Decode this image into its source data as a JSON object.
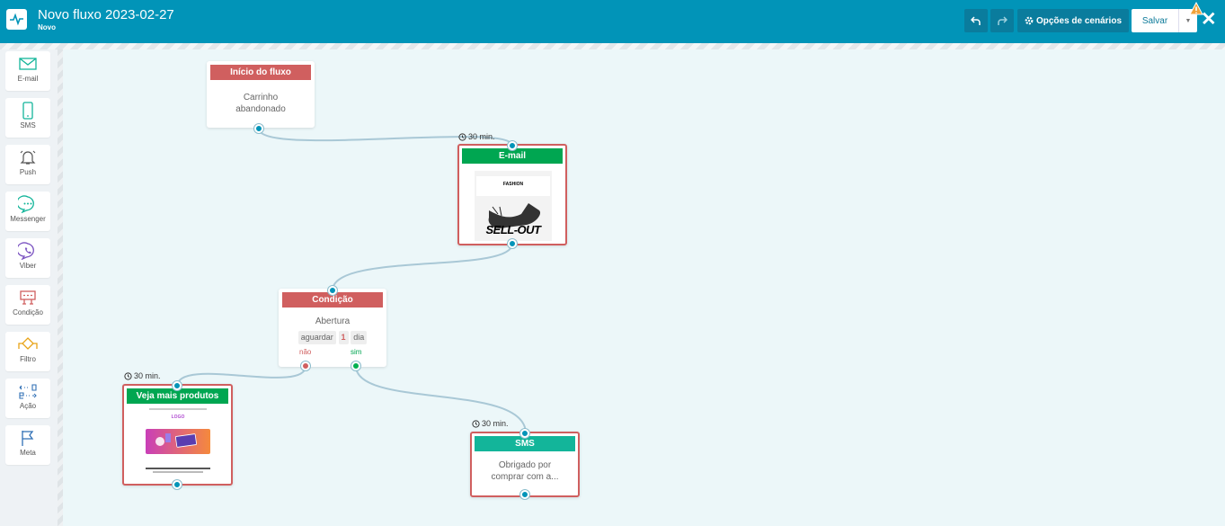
{
  "header": {
    "title": "Novo fluxo 2023-02-27",
    "subtitle": "Novo",
    "options_label": "Opções de cenários",
    "save_label": "Salvar",
    "accent": "#0194b8"
  },
  "sidebar": {
    "items": [
      {
        "label": "E-mail",
        "icon": "email-icon"
      },
      {
        "label": "SMS",
        "icon": "sms-icon"
      },
      {
        "label": "Push",
        "icon": "bell-icon"
      },
      {
        "label": "Messenger",
        "icon": "messenger-icon"
      },
      {
        "label": "Viber",
        "icon": "viber-icon"
      },
      {
        "label": "Condição",
        "icon": "condition-icon"
      },
      {
        "label": "Filtro",
        "icon": "filter-icon"
      },
      {
        "label": "Ação",
        "icon": "action-icon"
      },
      {
        "label": "Meta",
        "icon": "flag-icon"
      }
    ]
  },
  "nodes": {
    "start": {
      "header": "Início do fluxo",
      "body": "Carrinho abandonado"
    },
    "email": {
      "header": "E-mail",
      "delay": "30 min.",
      "thumb_brand": "FASHION",
      "thumb_text": "SELL-OUT"
    },
    "condition": {
      "header": "Condição",
      "body": "Abertura",
      "wait_label": "aguardar",
      "wait_value": "1",
      "wait_unit": "dia",
      "no_label": "não",
      "yes_label": "sim"
    },
    "products": {
      "header": "Veja mais produtos",
      "delay": "30 min.",
      "thumb_logo": "LOGO"
    },
    "sms": {
      "header": "SMS",
      "delay": "30 min.",
      "body": "Obrigado por comprar com a..."
    }
  },
  "colors": {
    "red": "#d05f5f",
    "green": "#00a651",
    "teal": "#13b59a",
    "wire": "#a9c8d6"
  }
}
